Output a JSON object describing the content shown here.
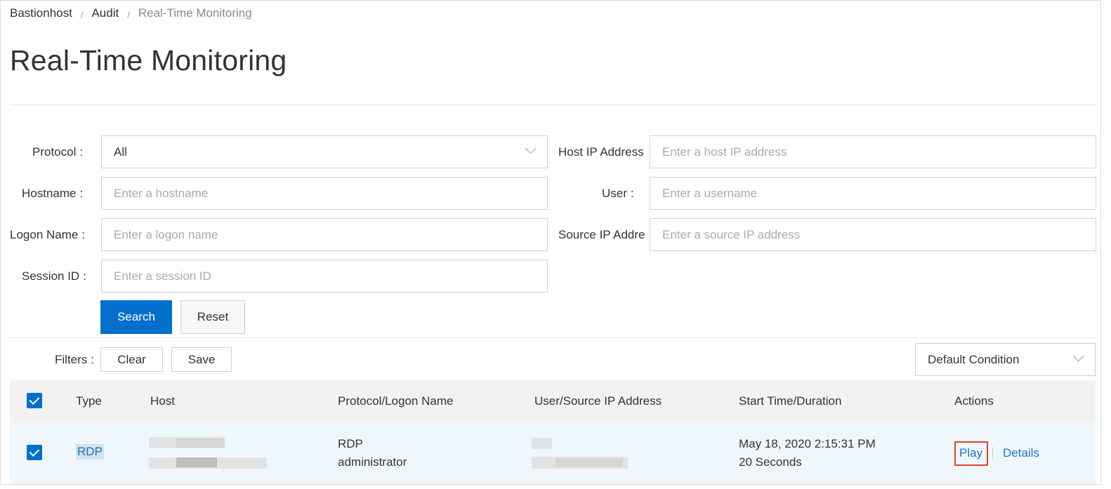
{
  "breadcrumb": {
    "items": [
      "Bastionhost",
      "Audit"
    ],
    "separator": "/",
    "current": "Real-Time Monitoring"
  },
  "page": {
    "title": "Real-Time Monitoring"
  },
  "form": {
    "protocol": {
      "label": "Protocol",
      "value": "All"
    },
    "host_ip": {
      "label": "Host IP Address",
      "placeholder": "Enter a host IP address"
    },
    "hostname": {
      "label": "Hostname",
      "placeholder": "Enter a hostname"
    },
    "user": {
      "label": "User",
      "placeholder": "Enter a username"
    },
    "logon_name": {
      "label": "Logon Name",
      "placeholder": "Enter a logon name"
    },
    "source_ip": {
      "label": "Source IP Addre",
      "placeholder": "Enter a source IP address"
    },
    "session_id": {
      "label": "Session ID",
      "placeholder": "Enter a session ID"
    },
    "search_label": "Search",
    "reset_label": "Reset",
    "colon": ":"
  },
  "filters": {
    "label": "Filters",
    "clear_label": "Clear",
    "save_label": "Save",
    "condition": "Default Condition"
  },
  "table": {
    "columns": [
      "Type",
      "Host",
      "Protocol/Logon Name",
      "User/Source IP Address",
      "Start Time/Duration",
      "Actions"
    ],
    "rows": [
      {
        "type": "RDP",
        "protocol": "RDP",
        "logon_name": "administrator",
        "start_time": "May 18, 2020 2:15:31 PM",
        "duration": "20 Seconds",
        "actions": [
          "Play",
          "Details"
        ]
      }
    ]
  },
  "colors": {
    "primary": "#0070cc",
    "link": "#1a73c9",
    "highlight_border": "#e2432b",
    "row_selected_bg": "#f0f7fc"
  }
}
